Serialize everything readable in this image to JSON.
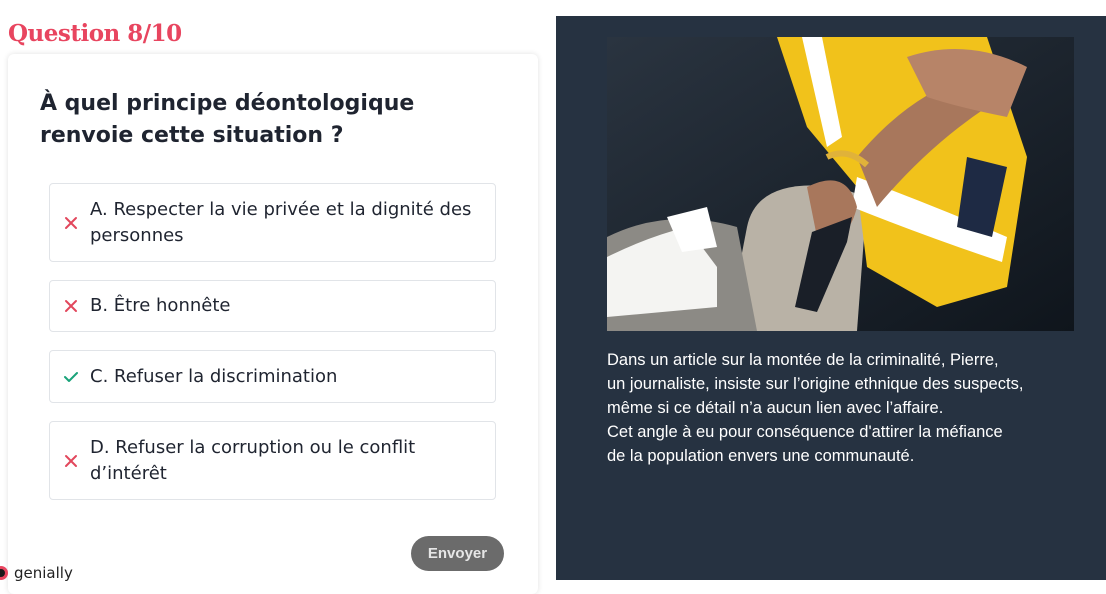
{
  "header": {
    "question_number": "Question 8/10"
  },
  "question": {
    "text": "À quel principe déontologique renvoie cette situation ?"
  },
  "answers": [
    {
      "label": "A. Respecter la vie privée et la dignité des personnes",
      "status": "wrong"
    },
    {
      "label": "B. Être honnête",
      "status": "wrong"
    },
    {
      "label": "C. Refuser la discrimination",
      "status": "correct"
    },
    {
      "label": "D. Refuser la corruption ou le conflit d’intérêt",
      "status": "wrong"
    }
  ],
  "actions": {
    "submit_label": "Envoyer"
  },
  "branding": {
    "logo_text": "genially"
  },
  "context": {
    "lines": [
      "Dans un article sur la montée de la criminalité, Pierre,",
      "un journaliste, insiste sur l’origine ethnique des suspects,",
      "même si ce détail n’a aucun lien avec l’affaire.",
      "Cet angle à eu pour conséquence d'attirer la méfiance",
      "de la population envers une communauté."
    ]
  },
  "colors": {
    "accent": "#e8455f",
    "wrong": "#e2475c",
    "correct": "#1aa37a",
    "panel": "#263241"
  }
}
